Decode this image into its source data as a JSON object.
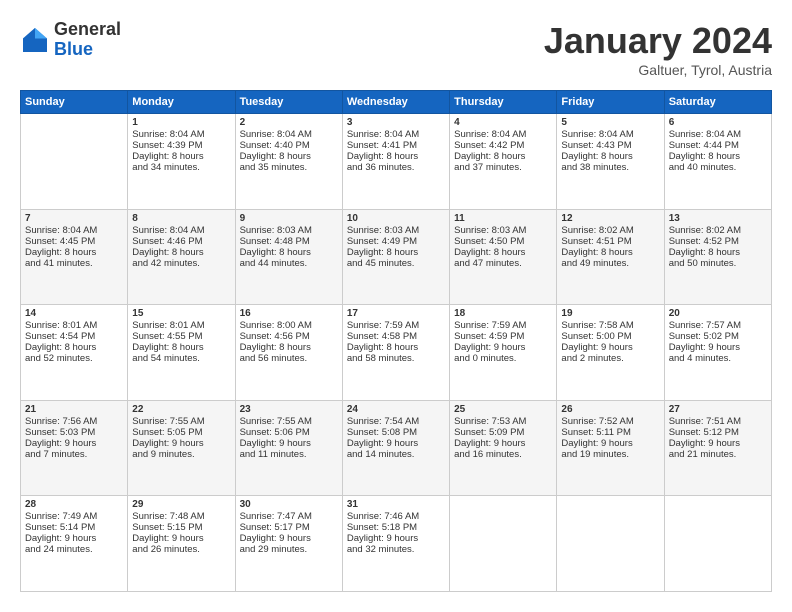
{
  "header": {
    "logo": {
      "text_general": "General",
      "text_blue": "Blue"
    },
    "title": "January 2024",
    "subtitle": "Galtuer, Tyrol, Austria"
  },
  "days_of_week": [
    "Sunday",
    "Monday",
    "Tuesday",
    "Wednesday",
    "Thursday",
    "Friday",
    "Saturday"
  ],
  "weeks": [
    [
      {
        "day": "",
        "data": ""
      },
      {
        "day": "1",
        "data": "Sunrise: 8:04 AM\nSunset: 4:39 PM\nDaylight: 8 hours\nand 34 minutes."
      },
      {
        "day": "2",
        "data": "Sunrise: 8:04 AM\nSunset: 4:40 PM\nDaylight: 8 hours\nand 35 minutes."
      },
      {
        "day": "3",
        "data": "Sunrise: 8:04 AM\nSunset: 4:41 PM\nDaylight: 8 hours\nand 36 minutes."
      },
      {
        "day": "4",
        "data": "Sunrise: 8:04 AM\nSunset: 4:42 PM\nDaylight: 8 hours\nand 37 minutes."
      },
      {
        "day": "5",
        "data": "Sunrise: 8:04 AM\nSunset: 4:43 PM\nDaylight: 8 hours\nand 38 minutes."
      },
      {
        "day": "6",
        "data": "Sunrise: 8:04 AM\nSunset: 4:44 PM\nDaylight: 8 hours\nand 40 minutes."
      }
    ],
    [
      {
        "day": "7",
        "data": "Sunrise: 8:04 AM\nSunset: 4:45 PM\nDaylight: 8 hours\nand 41 minutes."
      },
      {
        "day": "8",
        "data": "Sunrise: 8:04 AM\nSunset: 4:46 PM\nDaylight: 8 hours\nand 42 minutes."
      },
      {
        "day": "9",
        "data": "Sunrise: 8:03 AM\nSunset: 4:48 PM\nDaylight: 8 hours\nand 44 minutes."
      },
      {
        "day": "10",
        "data": "Sunrise: 8:03 AM\nSunset: 4:49 PM\nDaylight: 8 hours\nand 45 minutes."
      },
      {
        "day": "11",
        "data": "Sunrise: 8:03 AM\nSunset: 4:50 PM\nDaylight: 8 hours\nand 47 minutes."
      },
      {
        "day": "12",
        "data": "Sunrise: 8:02 AM\nSunset: 4:51 PM\nDaylight: 8 hours\nand 49 minutes."
      },
      {
        "day": "13",
        "data": "Sunrise: 8:02 AM\nSunset: 4:52 PM\nDaylight: 8 hours\nand 50 minutes."
      }
    ],
    [
      {
        "day": "14",
        "data": "Sunrise: 8:01 AM\nSunset: 4:54 PM\nDaylight: 8 hours\nand 52 minutes."
      },
      {
        "day": "15",
        "data": "Sunrise: 8:01 AM\nSunset: 4:55 PM\nDaylight: 8 hours\nand 54 minutes."
      },
      {
        "day": "16",
        "data": "Sunrise: 8:00 AM\nSunset: 4:56 PM\nDaylight: 8 hours\nand 56 minutes."
      },
      {
        "day": "17",
        "data": "Sunrise: 7:59 AM\nSunset: 4:58 PM\nDaylight: 8 hours\nand 58 minutes."
      },
      {
        "day": "18",
        "data": "Sunrise: 7:59 AM\nSunset: 4:59 PM\nDaylight: 9 hours\nand 0 minutes."
      },
      {
        "day": "19",
        "data": "Sunrise: 7:58 AM\nSunset: 5:00 PM\nDaylight: 9 hours\nand 2 minutes."
      },
      {
        "day": "20",
        "data": "Sunrise: 7:57 AM\nSunset: 5:02 PM\nDaylight: 9 hours\nand 4 minutes."
      }
    ],
    [
      {
        "day": "21",
        "data": "Sunrise: 7:56 AM\nSunset: 5:03 PM\nDaylight: 9 hours\nand 7 minutes."
      },
      {
        "day": "22",
        "data": "Sunrise: 7:55 AM\nSunset: 5:05 PM\nDaylight: 9 hours\nand 9 minutes."
      },
      {
        "day": "23",
        "data": "Sunrise: 7:55 AM\nSunset: 5:06 PM\nDaylight: 9 hours\nand 11 minutes."
      },
      {
        "day": "24",
        "data": "Sunrise: 7:54 AM\nSunset: 5:08 PM\nDaylight: 9 hours\nand 14 minutes."
      },
      {
        "day": "25",
        "data": "Sunrise: 7:53 AM\nSunset: 5:09 PM\nDaylight: 9 hours\nand 16 minutes."
      },
      {
        "day": "26",
        "data": "Sunrise: 7:52 AM\nSunset: 5:11 PM\nDaylight: 9 hours\nand 19 minutes."
      },
      {
        "day": "27",
        "data": "Sunrise: 7:51 AM\nSunset: 5:12 PM\nDaylight: 9 hours\nand 21 minutes."
      }
    ],
    [
      {
        "day": "28",
        "data": "Sunrise: 7:49 AM\nSunset: 5:14 PM\nDaylight: 9 hours\nand 24 minutes."
      },
      {
        "day": "29",
        "data": "Sunrise: 7:48 AM\nSunset: 5:15 PM\nDaylight: 9 hours\nand 26 minutes."
      },
      {
        "day": "30",
        "data": "Sunrise: 7:47 AM\nSunset: 5:17 PM\nDaylight: 9 hours\nand 29 minutes."
      },
      {
        "day": "31",
        "data": "Sunrise: 7:46 AM\nSunset: 5:18 PM\nDaylight: 9 hours\nand 32 minutes."
      },
      {
        "day": "",
        "data": ""
      },
      {
        "day": "",
        "data": ""
      },
      {
        "day": "",
        "data": ""
      }
    ]
  ]
}
